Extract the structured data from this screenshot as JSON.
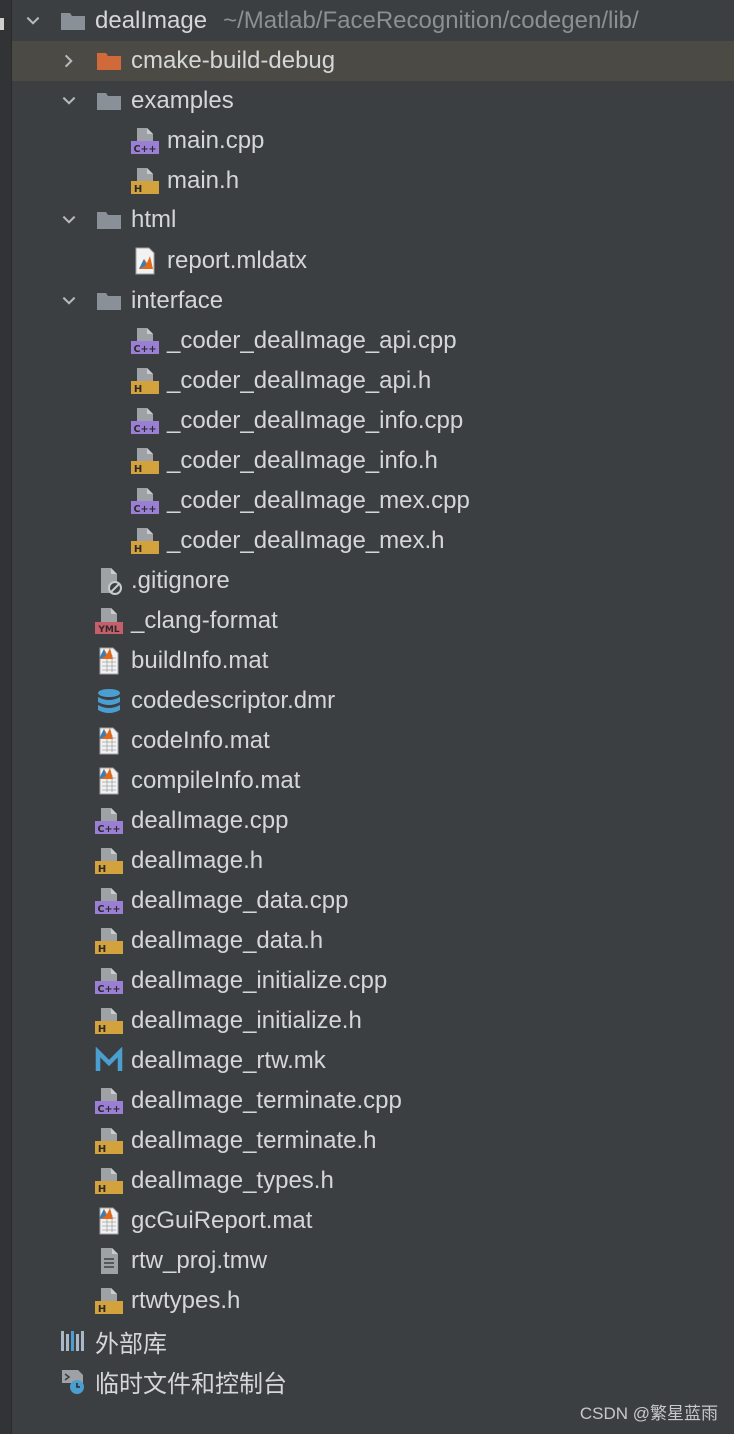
{
  "tree": {
    "root": {
      "label": "dealImage",
      "path": "~/Matlab/FaceRecognition/codegen/lib/"
    },
    "items": [
      {
        "label": "cmake-build-debug",
        "icon": "folder-orange-icon"
      },
      {
        "label": "examples",
        "icon": "folder-icon"
      },
      {
        "label": "main.cpp",
        "icon": "cpp-file-icon"
      },
      {
        "label": "main.h",
        "icon": "h-file-icon"
      },
      {
        "label": "html",
        "icon": "folder-icon"
      },
      {
        "label": "report.mldatx",
        "icon": "matlab-file-icon"
      },
      {
        "label": "interface",
        "icon": "folder-icon"
      },
      {
        "label": "_coder_dealImage_api.cpp",
        "icon": "cpp-file-icon"
      },
      {
        "label": "_coder_dealImage_api.h",
        "icon": "h-file-icon"
      },
      {
        "label": "_coder_dealImage_info.cpp",
        "icon": "cpp-file-icon"
      },
      {
        "label": "_coder_dealImage_info.h",
        "icon": "h-file-icon"
      },
      {
        "label": "_coder_dealImage_mex.cpp",
        "icon": "cpp-file-icon"
      },
      {
        "label": "_coder_dealImage_mex.h",
        "icon": "h-file-icon"
      },
      {
        "label": ".gitignore",
        "icon": "gitignore-file-icon"
      },
      {
        "label": "_clang-format",
        "icon": "yml-file-icon"
      },
      {
        "label": "buildInfo.mat",
        "icon": "mat-file-icon"
      },
      {
        "label": "codedescriptor.dmr",
        "icon": "database-icon"
      },
      {
        "label": "codeInfo.mat",
        "icon": "mat-file-icon"
      },
      {
        "label": "compileInfo.mat",
        "icon": "mat-file-icon"
      },
      {
        "label": "dealImage.cpp",
        "icon": "cpp-file-icon"
      },
      {
        "label": "dealImage.h",
        "icon": "h-file-icon"
      },
      {
        "label": "dealImage_data.cpp",
        "icon": "cpp-file-icon"
      },
      {
        "label": "dealImage_data.h",
        "icon": "h-file-icon"
      },
      {
        "label": "dealImage_initialize.cpp",
        "icon": "cpp-file-icon"
      },
      {
        "label": "dealImage_initialize.h",
        "icon": "h-file-icon"
      },
      {
        "label": "dealImage_rtw.mk",
        "icon": "makefile-icon"
      },
      {
        "label": "dealImage_terminate.cpp",
        "icon": "cpp-file-icon"
      },
      {
        "label": "dealImage_terminate.h",
        "icon": "h-file-icon"
      },
      {
        "label": "dealImage_types.h",
        "icon": "h-file-icon"
      },
      {
        "label": "gcGuiReport.mat",
        "icon": "mat-file-icon"
      },
      {
        "label": "rtw_proj.tmw",
        "icon": "text-file-icon"
      },
      {
        "label": "rtwtypes.h",
        "icon": "h-file-icon"
      }
    ],
    "external_libraries": {
      "label": "外部库",
      "icon": "library-icon"
    },
    "scratches": {
      "label": "临时文件和控制台",
      "icon": "scratches-icon"
    }
  },
  "icon_badges": {
    "cpp": "C++",
    "h": "H",
    "yml": "YML"
  },
  "watermark": "CSDN @繁星蓝雨",
  "colors": {
    "background": "#3c3f41",
    "selection": "#4b4a44",
    "text": "#d4d6d8",
    "path_text": "#8c8f93",
    "folder": "#8a9097",
    "excluded_folder": "#d06a3a",
    "cpp_badge": "#9b7fd4",
    "h_badge": "#d3a23c",
    "yml_badge": "#c75e6c",
    "database": "#4a9fd0"
  }
}
